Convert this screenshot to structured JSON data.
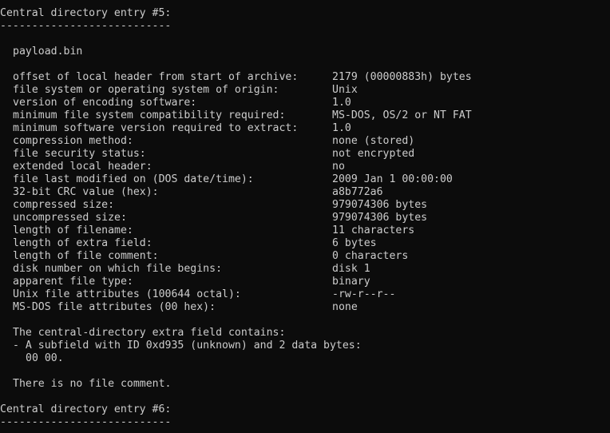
{
  "entry_header": {
    "title": "Central directory entry #5:",
    "rule": "---------------------------"
  },
  "filename": "payload.bin",
  "fields": [
    {
      "label": "offset of local header from start of archive:",
      "value": "2179 (00000883h) bytes"
    },
    {
      "label": "file system or operating system of origin:",
      "value": "Unix"
    },
    {
      "label": "version of encoding software:",
      "value": "1.0"
    },
    {
      "label": "minimum file system compatibility required:",
      "value": "MS-DOS, OS/2 or NT FAT"
    },
    {
      "label": "minimum software version required to extract:",
      "value": "1.0"
    },
    {
      "label": "compression method:",
      "value": "none (stored)"
    },
    {
      "label": "file security status:",
      "value": "not encrypted"
    },
    {
      "label": "extended local header:",
      "value": "no"
    },
    {
      "label": "file last modified on (DOS date/time):",
      "value": "2009 Jan 1 00:00:00"
    },
    {
      "label": "32-bit CRC value (hex):",
      "value": "a8b772a6"
    },
    {
      "label": "compressed size:",
      "value": "979074306 bytes"
    },
    {
      "label": "uncompressed size:",
      "value": "979074306 bytes"
    },
    {
      "label": "length of filename:",
      "value": "11 characters"
    },
    {
      "label": "length of extra field:",
      "value": "6 bytes"
    },
    {
      "label": "length of file comment:",
      "value": "0 characters"
    },
    {
      "label": "disk number on which file begins:",
      "value": "disk 1"
    },
    {
      "label": "apparent file type:",
      "value": "binary"
    },
    {
      "label": "Unix file attributes (100644 octal):",
      "value": "-rw-r--r--"
    },
    {
      "label": "MS-DOS file attributes (00 hex):",
      "value": "none"
    }
  ],
  "extra_field": {
    "intro": "The central-directory extra field contains:",
    "subfield": "- A subfield with ID 0xd935 (unknown) and 2 data bytes:",
    "bytes": "00 00."
  },
  "comment_note": "There is no file comment.",
  "next_entry": {
    "title": "Central directory entry #6:",
    "rule": "---------------------------"
  }
}
